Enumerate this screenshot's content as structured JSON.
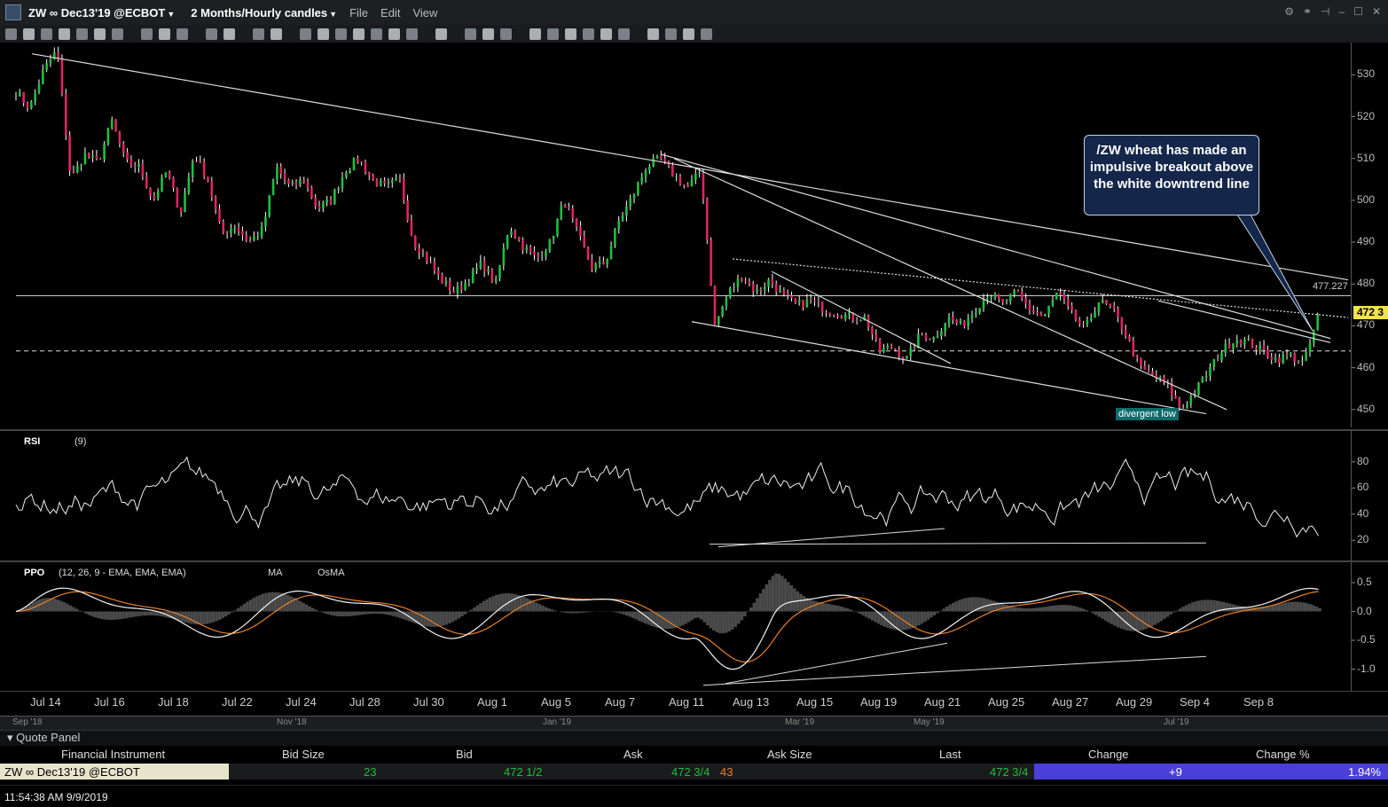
{
  "title_bar": {
    "symbol": "ZW ∞ Dec13'19 @ECBOT",
    "range": "2 Months/Hourly candles",
    "menu": [
      "File",
      "Edit",
      "View"
    ]
  },
  "chart_data": [
    {
      "type": "candlestick",
      "pane": "price",
      "ylim": [
        447,
        536
      ],
      "y_ticks": [
        450,
        460,
        470,
        480,
        490,
        500,
        510,
        520,
        530
      ],
      "horizontal_line": {
        "value": 477.227,
        "label": "477.227"
      },
      "last_price_label": "472 3",
      "approx_closes": [
        526,
        522,
        531,
        536,
        505,
        511,
        509,
        519,
        509,
        508,
        500,
        507,
        497,
        511,
        505,
        492,
        494,
        490,
        493,
        508,
        503,
        505,
        498,
        500,
        507,
        510,
        505,
        503,
        505,
        490,
        486,
        481,
        478,
        481,
        485,
        480,
        494,
        489,
        486,
        490,
        500,
        492,
        484,
        485,
        495,
        501,
        508,
        510,
        506,
        503,
        507,
        470,
        478,
        482,
        478,
        481,
        477,
        475,
        476,
        474,
        473,
        472,
        472,
        464,
        465,
        462,
        468,
        467,
        472,
        470,
        474,
        478,
        475,
        478,
        474,
        472,
        478,
        473,
        469,
        476,
        474,
        468,
        460,
        458,
        456,
        450,
        454,
        459,
        464,
        467,
        466,
        464,
        462,
        463,
        461,
        472
      ],
      "annotations": [
        "/ZW wheat has made an impulsive breakout above the white downtrend line",
        "divergent low"
      ]
    },
    {
      "type": "line",
      "pane": "RSI",
      "title": "RSI",
      "params": "(9)",
      "ylim": [
        10,
        90
      ],
      "y_ticks": [
        20,
        40,
        60,
        80
      ]
    },
    {
      "type": "line",
      "pane": "PPO",
      "title": "PPO",
      "params": "(12, 26, 9 - EMA, EMA, EMA)",
      "legend": [
        "MA",
        "OsMA"
      ],
      "ylim": [
        -1.3,
        0.7
      ],
      "y_ticks": [
        0.5,
        0.0,
        -0.5,
        -1.0
      ],
      "y_tick_labels": [
        "0.5",
        "0.0",
        "-0.5",
        "-1.0"
      ]
    }
  ],
  "x_axis": {
    "labels": [
      "Jul 14",
      "Jul 16",
      "Jul 18",
      "Jul 22",
      "Jul 24",
      "Jul 28",
      "Jul 30",
      "Aug 1",
      "Aug 5",
      "Aug 7",
      "Aug 11",
      "Aug 13",
      "Aug 15",
      "Aug 19",
      "Aug 21",
      "Aug 25",
      "Aug 27",
      "Aug 29",
      "Sep 4",
      "Sep 8"
    ]
  },
  "overview_axis": {
    "labels": [
      "Sep '18",
      "Nov '18",
      "Jan '19",
      "Mar '19",
      "May '19",
      "Jul '19"
    ]
  },
  "quote_panel": {
    "title": "Quote Panel",
    "columns": [
      "Financial Instrument",
      "Bid Size",
      "Bid",
      "Ask",
      "Ask Size",
      "Last",
      "Change",
      "Change %"
    ],
    "row": {
      "instrument": "ZW ∞ Dec13'19 @ECBOT",
      "bid_size": "23",
      "bid": "472 1/2",
      "ask": "472 3/4",
      "ask_size": "43",
      "last": "472 3/4",
      "change": "+9",
      "change_pct": "1.94%"
    }
  },
  "status": {
    "timestamp": "11:54:38 AM 9/9/2019"
  },
  "colors": {
    "up": "#1fbf3a",
    "down": "#e0245e",
    "change_bg": "#4a3fd8",
    "last_bg": "#f2e34b"
  }
}
